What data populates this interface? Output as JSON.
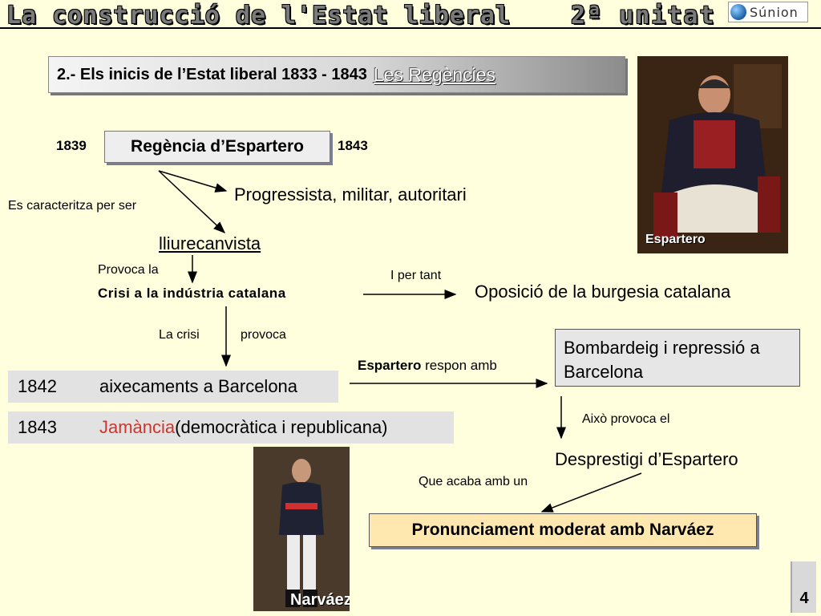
{
  "header": {
    "title": "La construcció de l'Estat liberal",
    "unit": "2ª unitat",
    "logo_text": "Súnion"
  },
  "title_bar": {
    "main": "2.- Els inicis de l’Estat liberal 1833 - 1843",
    "sub": "Les Regències"
  },
  "regencia": {
    "start_year": "1839",
    "label": "Regència d’Espartero",
    "end_year": "1843"
  },
  "flow": {
    "characterized_label": "Es caracteritza per ser",
    "traits": "Progressista, militar, autoritari",
    "free_trade": "lliurecanvista",
    "provokes_label": "Provoca la",
    "crisis": "Crisi a la indústria catalana",
    "therefore_label": "I per tant",
    "opposition": "Oposició de la burgesia catalana",
    "crisis_label": "La crisi",
    "provokes2": "provoca",
    "responds_bold": "Espartero",
    "responds_rest": " respon amb",
    "bombing": "Bombardeig i repressió a Barcelona",
    "this_provokes": "Això provoca el",
    "discredit": "Desprestigi d’Espartero",
    "ends_with": "Que acaba amb un",
    "pronunciamiento": "Pronunciament moderat amb Narváez"
  },
  "events": [
    {
      "year": "1842",
      "text": "aixecaments a Barcelona"
    },
    {
      "year": "1843",
      "highlight": "Jamància",
      "text": " (democràtica i republicana)"
    }
  ],
  "portraits": {
    "espartero": "Espartero",
    "narvaez": "Narváez"
  },
  "page_number": "4",
  "colors": {
    "background": "#ffffdd",
    "highlight_red": "#d0342c",
    "pron_fill": "#ffe8b0"
  }
}
